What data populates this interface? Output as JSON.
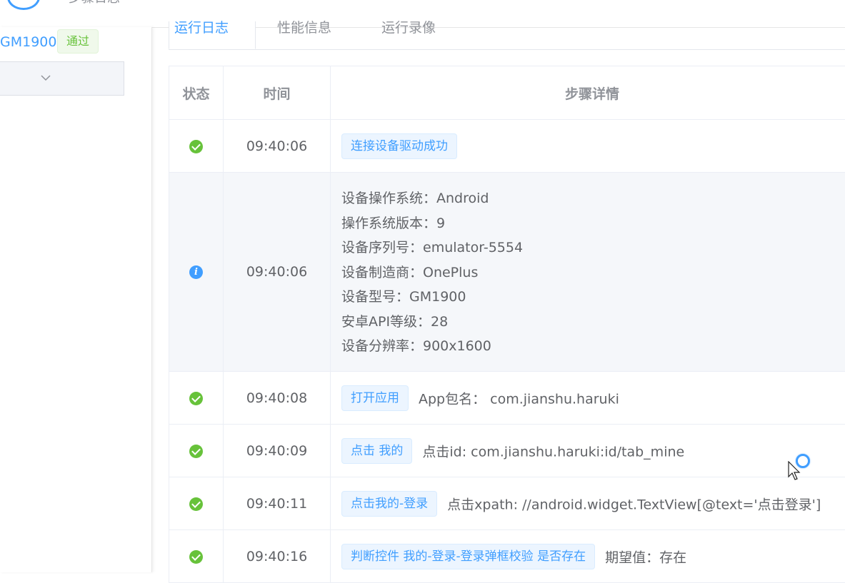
{
  "header": {
    "title": "步骤日志"
  },
  "sidebar": {
    "device_name": "GM1900",
    "result_tag": "通过"
  },
  "tabs": [
    {
      "label": "运行日志",
      "active": true
    },
    {
      "label": "性能信息",
      "active": false
    },
    {
      "label": "运行录像",
      "active": false
    }
  ],
  "table": {
    "headers": {
      "status": "状态",
      "time": "时间",
      "detail": "步骤详情"
    },
    "rows": [
      {
        "status": "success",
        "time": "09:40:06",
        "tag": "连接设备驱动成功",
        "text": ""
      },
      {
        "status": "info",
        "time": "09:40:06",
        "lines": [
          "设备操作系统：Android",
          "操作系统版本：9",
          "设备序列号：emulator-5554",
          "设备制造商：OnePlus",
          "设备型号：GM1900",
          "安卓API等级：28",
          "设备分辨率：900x1600"
        ]
      },
      {
        "status": "success",
        "time": "09:40:08",
        "tag": "打开应用",
        "text": "App包名： com.jianshu.haruki"
      },
      {
        "status": "success",
        "time": "09:40:09",
        "tag": "点击 我的",
        "text": "点击id: com.jianshu.haruki:id/tab_mine"
      },
      {
        "status": "success",
        "time": "09:40:11",
        "tag": "点击我的-登录",
        "text": "点击xpath: //android.widget.TextView[@text='点击登录']"
      },
      {
        "status": "success",
        "time": "09:40:16",
        "tag": "判断控件 我的-登录-登录弹框校验 是否存在",
        "text": "期望值：存在"
      }
    ]
  },
  "colors": {
    "primary": "#409eff",
    "success": "#67c23a",
    "info_row_bg": "#f5f7fa"
  },
  "icons": {
    "success": "check-circle-icon",
    "info": "info-circle-icon",
    "collapse": "chevron-down-icon"
  }
}
